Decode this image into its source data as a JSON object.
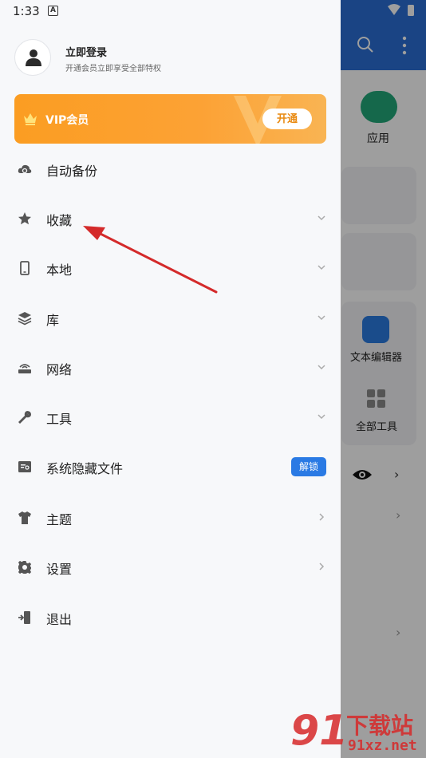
{
  "status_bar": {
    "time": "1:33",
    "notif_letter": "A"
  },
  "background_app": {
    "labels": {
      "apps": "应用",
      "text_editor": "文本编辑器",
      "all_tools": "全部工具"
    }
  },
  "account": {
    "title": "立即登录",
    "subtitle": "开通会员立即享受全部特权"
  },
  "vip": {
    "label": "VIP会员",
    "button": "开通"
  },
  "menu": {
    "items": [
      {
        "label": "自动备份",
        "icon": "cloud-sync-icon"
      },
      {
        "label": "收藏",
        "icon": "star-icon"
      },
      {
        "label": "本地",
        "icon": "phone-icon"
      },
      {
        "label": "库",
        "icon": "layers-icon"
      },
      {
        "label": "网络",
        "icon": "router-icon"
      },
      {
        "label": "工具",
        "icon": "wrench-icon"
      },
      {
        "label": "系统隐藏文件",
        "icon": "hidden-file-icon",
        "badge": "解锁"
      },
      {
        "label": "主题",
        "icon": "tshirt-icon"
      },
      {
        "label": "设置",
        "icon": "gear-icon"
      },
      {
        "label": "退出",
        "icon": "exit-icon"
      }
    ]
  },
  "watermark": {
    "digits": "91",
    "name": "下载站",
    "url": "91xz.net"
  },
  "colors": {
    "header_blue": "#2a6fd6",
    "vip_orange": "#fb9d22",
    "badge_blue": "#2a7ae4",
    "arrow_red": "#d42a2a"
  }
}
